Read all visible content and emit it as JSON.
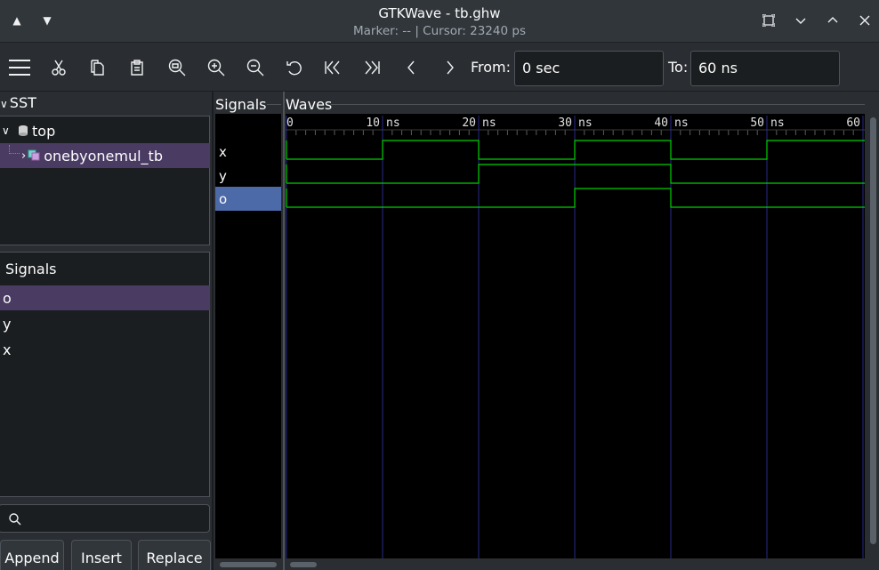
{
  "window": {
    "title": "GTKWave - tb.ghw",
    "subtitle": "Marker: --  |  Cursor: 23240 ps"
  },
  "toolbar": {
    "icons": [
      "menu-icon",
      "cut-icon",
      "copy-icon",
      "paste-icon",
      "zoom-fit-icon",
      "zoom-in-icon",
      "zoom-out-icon",
      "undo-icon",
      "go-start-icon",
      "go-end-icon",
      "prev-icon",
      "next-icon"
    ],
    "from_label": "From:",
    "from_value": "0 sec",
    "to_label": "To:",
    "to_value": "60 ns"
  },
  "sst": {
    "header": "SST",
    "tree": [
      {
        "label": "top",
        "level": 0,
        "expanded": true
      },
      {
        "label": "onebyonemul_tb",
        "level": 1,
        "expanded": false,
        "selected": true
      }
    ]
  },
  "signals_pane": {
    "header": "Signals",
    "items": [
      {
        "label": "o",
        "selected": true
      },
      {
        "label": "y",
        "selected": false
      },
      {
        "label": "x",
        "selected": false
      }
    ]
  },
  "buttons": {
    "append": "Append",
    "insert": "Insert",
    "replace": "Replace"
  },
  "wave_view": {
    "signals_header": "Signals",
    "waves_header": "Waves",
    "signals": [
      {
        "name": "x",
        "selected": false
      },
      {
        "name": "y",
        "selected": false
      },
      {
        "name": "o",
        "selected": true
      }
    ],
    "time_labels": [
      "0",
      "10",
      "ns",
      "20",
      "ns",
      "30",
      "ns",
      "40",
      "ns",
      "50",
      "ns",
      "60"
    ],
    "time_range_ns": [
      0,
      60
    ],
    "major_ticks_ns": [
      0,
      10,
      20,
      30,
      40,
      50,
      60
    ],
    "trace_color": "#00d000",
    "grid_color": "#2a2a8a",
    "waveforms": {
      "x": [
        [
          0,
          0
        ],
        [
          10,
          1
        ],
        [
          20,
          0
        ],
        [
          30,
          1
        ],
        [
          40,
          0
        ],
        [
          50,
          1
        ]
      ],
      "y": [
        [
          0,
          0
        ],
        [
          20,
          1
        ],
        [
          40,
          0
        ]
      ],
      "o": [
        [
          0,
          0
        ],
        [
          30,
          1
        ],
        [
          40,
          0
        ]
      ]
    }
  }
}
